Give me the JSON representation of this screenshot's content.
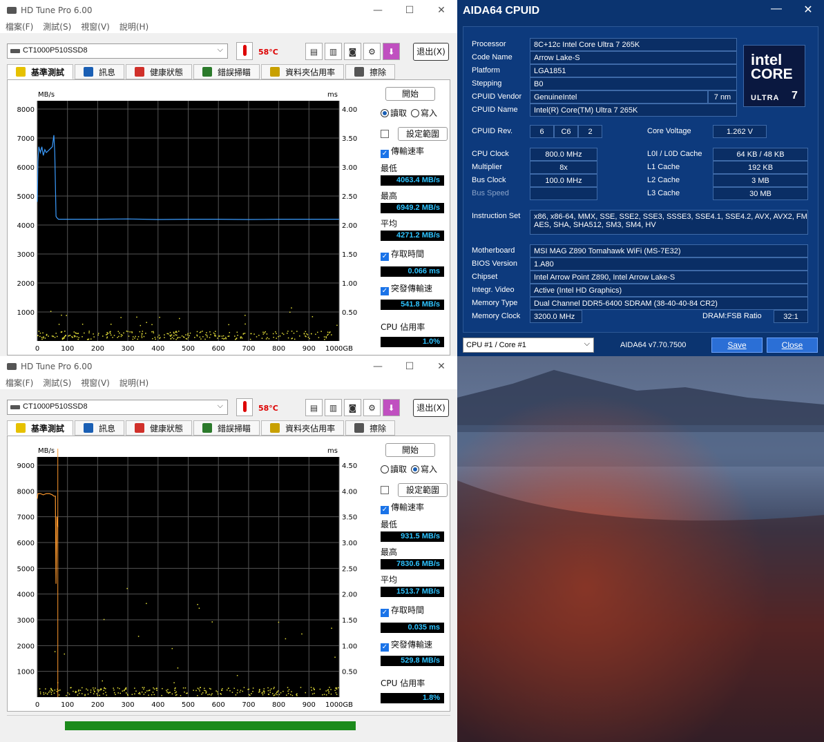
{
  "hd_windows": [
    {
      "title": "HD Tune Pro 6.00",
      "menu": [
        "檔案(F)",
        "測試(S)",
        "視窗(V)",
        "說明(H)"
      ],
      "drive": "CT1000P510SSD8",
      "temp": "58°C",
      "exit_label": "退出(X)",
      "tabs": [
        "基準測試",
        "訊息",
        "健康狀態",
        "錯誤掃瞄",
        "資料夾佔用率",
        "擦除"
      ],
      "start_label": "開始",
      "read_label": "讀取",
      "write_label": "寫入",
      "mode": "read",
      "range_label": "設定範圍",
      "transfer_label": "傳輸速率",
      "min_label": "最低",
      "min_value": "4063.4 MB/s",
      "max_label": "最高",
      "max_value": "6949.2 MB/s",
      "avg_label": "平均",
      "avg_value": "4271.2 MB/s",
      "access_label": "存取時間",
      "access_value": "0.066 ms",
      "burst_label": "突發傳輸速",
      "burst_value": "541.8 MB/s",
      "cpu_label": "CPU 佔用率",
      "cpu_value": "1.0%"
    },
    {
      "title": "HD Tune Pro 6.00",
      "menu": [
        "檔案(F)",
        "測試(S)",
        "視窗(V)",
        "說明(H)"
      ],
      "drive": "CT1000P510SSD8",
      "temp": "58°C",
      "exit_label": "退出(X)",
      "tabs": [
        "基準測試",
        "訊息",
        "健康狀態",
        "錯誤掃瞄",
        "資料夾佔用率",
        "擦除"
      ],
      "start_label": "開始",
      "read_label": "讀取",
      "write_label": "寫入",
      "mode": "write",
      "range_label": "設定範圍",
      "transfer_label": "傳輸速率",
      "min_label": "最低",
      "min_value": "931.5 MB/s",
      "max_label": "最高",
      "max_value": "7830.6 MB/s",
      "avg_label": "平均",
      "avg_value": "1513.7 MB/s",
      "access_label": "存取時間",
      "access_value": "0.035 ms",
      "burst_label": "突發傳輸速",
      "burst_value": "529.8 MB/s",
      "cpu_label": "CPU 佔用率",
      "cpu_value": "1.8%"
    }
  ],
  "chart_data": [
    {
      "type": "line",
      "ylabel": "MB/s",
      "y2label": "ms",
      "x_ticks": [
        "0",
        "100",
        "200",
        "300",
        "400",
        "500",
        "600",
        "700",
        "800",
        "900",
        "1000GB"
      ],
      "y_ticks": [
        "8000",
        "7000",
        "6000",
        "5000",
        "4000",
        "3000",
        "2000",
        "1000"
      ],
      "y2_ticks": [
        "4.00",
        "3.50",
        "3.00",
        "2.50",
        "2.00",
        "1.50",
        "1.00",
        "0.50"
      ],
      "xlim": [
        0,
        1000
      ],
      "ylim": [
        0,
        8000
      ],
      "y2lim": [
        0,
        4
      ],
      "series": [
        {
          "color": "#3b9cff",
          "x": [
            0,
            2,
            5,
            10,
            15,
            20,
            25,
            30,
            40,
            50,
            55,
            58,
            62,
            65,
            70,
            100,
            200,
            300,
            400,
            500,
            600,
            700,
            800,
            900,
            1000
          ],
          "values": [
            4800,
            6200,
            6700,
            6500,
            6700,
            6400,
            6600,
            6500,
            6600,
            6700,
            7100,
            6500,
            4300,
            4250,
            4200,
            4200,
            4200,
            4210,
            4190,
            4200,
            4200,
            4190,
            4200,
            4200,
            4200
          ]
        }
      ],
      "grid": true
    },
    {
      "type": "line",
      "ylabel": "MB/s",
      "y2label": "ms",
      "x_ticks": [
        "0",
        "100",
        "200",
        "300",
        "400",
        "500",
        "600",
        "700",
        "800",
        "900",
        "1000GB"
      ],
      "y_ticks": [
        "9000",
        "8000",
        "7000",
        "6000",
        "5000",
        "4000",
        "3000",
        "2000",
        "1000"
      ],
      "y2_ticks": [
        "4.50",
        "4.00",
        "3.50",
        "3.00",
        "2.50",
        "2.00",
        "1.50",
        "1.00",
        "0.50"
      ],
      "xlim": [
        0,
        1000
      ],
      "ylim": [
        0,
        9000
      ],
      "y2lim": [
        0,
        4.5
      ],
      "series": [
        {
          "color": "#ff9a2e",
          "x": [
            0,
            2,
            10,
            20,
            30,
            40,
            50,
            55,
            60,
            62,
            65,
            68
          ],
          "values": [
            7700,
            7900,
            7900,
            7850,
            7900,
            7900,
            7850,
            7800,
            7800,
            4400,
            7000,
            6600
          ]
        }
      ],
      "grid": true
    }
  ],
  "aida": {
    "title": "AIDA64 CPUID",
    "rows1": [
      {
        "label": "Processor",
        "value": "8C+12c Intel Core Ultra 7 265K"
      },
      {
        "label": "Code Name",
        "value": "Arrow Lake-S"
      },
      {
        "label": "Platform",
        "value": "LGA1851"
      },
      {
        "label": "Stepping",
        "value": "B0"
      },
      {
        "label": "CPUID Vendor",
        "value": "GenuineIntel"
      },
      {
        "label": "CPUID Name",
        "value": "Intel(R) Core(TM) Ultra 7 265K"
      }
    ],
    "nm": "7 nm",
    "logo": {
      "brand": "intel",
      "line": "CORE",
      "tier": "ULTRA",
      "num": "7"
    },
    "cpuid_rev_label": "CPUID Rev.",
    "cpuid_rev": [
      "6",
      "C6",
      "2"
    ],
    "core_voltage_label": "Core Voltage",
    "core_voltage": "1.262 V",
    "clocks": [
      {
        "label": "CPU Clock",
        "value": "800.0 MHz"
      },
      {
        "label": "Multiplier",
        "value": "8x"
      },
      {
        "label": "Bus Clock",
        "value": "100.0 MHz"
      },
      {
        "label": "Bus Speed",
        "value": ""
      }
    ],
    "caches": [
      {
        "label": "L0I / L0D Cache",
        "value": "64 KB / 48 KB"
      },
      {
        "label": "L1 Cache",
        "value": "192 KB"
      },
      {
        "label": "L2 Cache",
        "value": "3 MB"
      },
      {
        "label": "L3 Cache",
        "value": "30 MB"
      }
    ],
    "iset_label": "Instruction Set",
    "iset_line1": "x86, x86-64, MMX, SSE, SSE2, SSE3, SSSE3, SSE4.1, SSE4.2, AVX, AVX2, FMA,",
    "iset_line2": "AES, SHA, SHA512, SM3, SM4, HV",
    "rows2": [
      {
        "label": "Motherboard",
        "value": "MSI MAG Z890 Tomahawk WiFi (MS-7E32)"
      },
      {
        "label": "BIOS Version",
        "value": "1.A80"
      },
      {
        "label": "Chipset",
        "value": "Intel Arrow Point Z890, Intel Arrow Lake-S"
      },
      {
        "label": "Integr. Video",
        "value": "Active  (Intel HD Graphics)"
      },
      {
        "label": "Memory Type",
        "value": "Dual Channel DDR5-6400 SDRAM  (38-40-40-84 CR2)"
      }
    ],
    "mem_clock_label": "Memory Clock",
    "mem_clock": "3200.0 MHz",
    "dram_ratio_label": "DRAM:FSB Ratio",
    "dram_ratio": "32:1",
    "cpu_select": "CPU #1 / Core #1",
    "version": "AIDA64 v7.70.7500",
    "save": "Save",
    "close": "Close"
  }
}
